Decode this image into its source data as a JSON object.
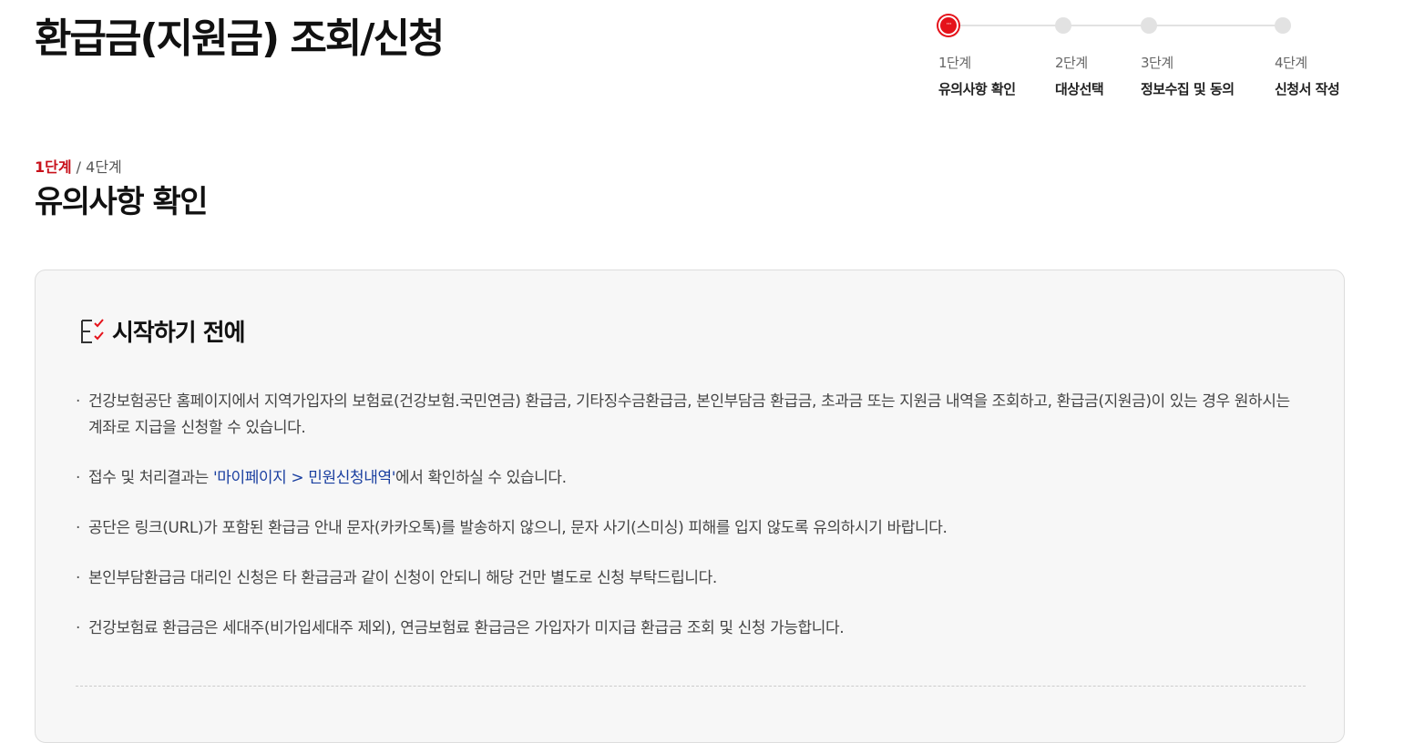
{
  "page": {
    "title": "환급금(지원금) 조회/신청"
  },
  "stepper": {
    "steps": [
      {
        "num": "1단계",
        "label": "유의사항 확인",
        "active": true
      },
      {
        "num": "2단계",
        "label": "대상선택",
        "active": false
      },
      {
        "num": "3단계",
        "label": "정보수집 및 동의",
        "active": false
      },
      {
        "num": "4단계",
        "label": "신청서 작성",
        "active": false
      }
    ],
    "active_dot_glyph": "···"
  },
  "section": {
    "current_step": "1단계",
    "separator": " / ",
    "total_steps": "4단계",
    "title": "유의사항 확인"
  },
  "notice": {
    "icon": "checklist-icon",
    "title": "시작하기 전에",
    "bullet": "·",
    "items": [
      {
        "text": "건강보험공단 홈페이지에서 지역가입자의 보험료(건강보험.국민연금) 환급금, 기타징수금환급금, 본인부담금 환급금, 초과금 또는 지원금 내역을 조회하고, 환급금(지원금)이 있는 경우 원하시는 계좌로 지급을 신청할 수 있습니다."
      },
      {
        "before": "접수 및 처리결과는 ",
        "link": "'마이페이지 > 민원신청내역'",
        "after": "에서 확인하실 수 있습니다."
      },
      {
        "text": "공단은 링크(URL)가 포함된 환급금 안내 문자(카카오톡)를 발송하지 않으니, 문자 사기(스미싱) 피해를 입지 않도록 유의하시기 바랍니다."
      },
      {
        "text": "본인부담환급금 대리인 신청은 타 환급금과 같이 신청이 안되니 해당 건만 별도로 신청 부탁드립니다."
      },
      {
        "text": "건강보험료 환급금은 세대주(비가입세대주 제외), 연금보험료 환급금은 가입자가 미지급 환급금 조회 및 신청 가능합니다."
      }
    ]
  },
  "colors": {
    "accent_red": "#e5121a",
    "step_current_text": "#c8101a",
    "link_blue": "#1a3fa0",
    "panel_bg": "#f7f7f7",
    "inactive_dot": "#e2e2e2"
  }
}
